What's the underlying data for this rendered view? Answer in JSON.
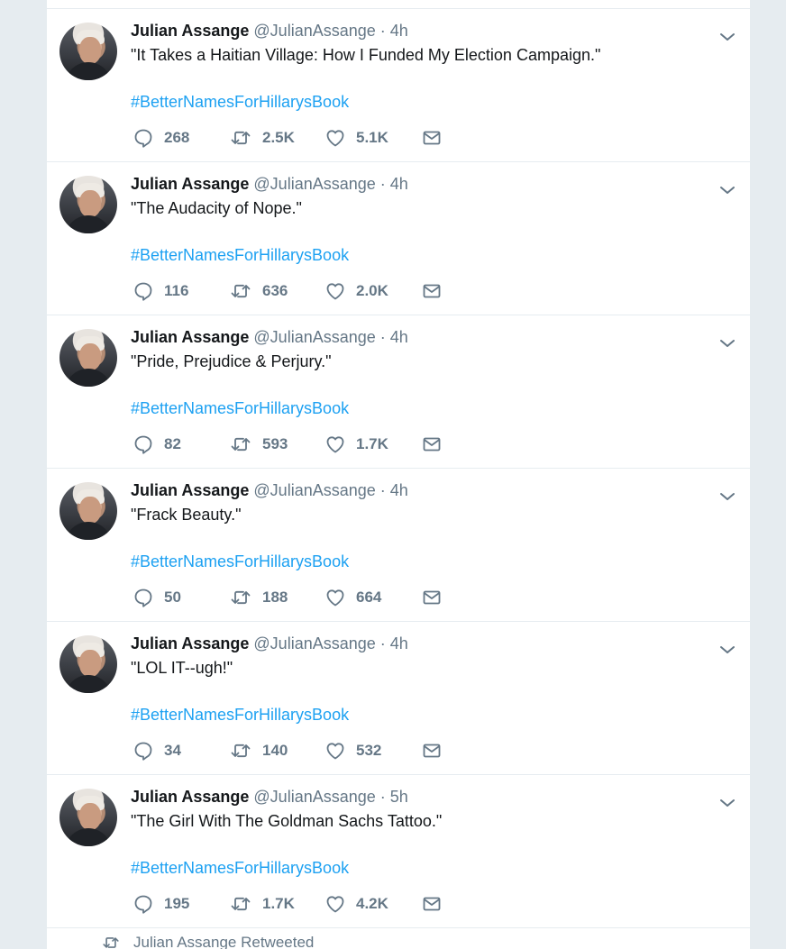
{
  "icons": {
    "reply": "speech-bubble-icon",
    "retweet": "retweet-arrows-icon",
    "like": "heart-icon",
    "dm": "envelope-icon",
    "caret": "chevron-down-icon"
  },
  "colors": {
    "link": "#1da1f2",
    "secondary_text": "#657786",
    "primary_text": "#14171a",
    "background": "#e6ecf0"
  },
  "tweets": [
    {
      "name": "Julian Assange",
      "handle": "@JulianAssange",
      "separator": "·",
      "time": "4h",
      "text": "\"It Takes a Haitian Village: How I Funded My Election Campaign.\"",
      "hashtag": "#BetterNamesForHillarysBook",
      "replies": "268",
      "retweets": "2.5K",
      "likes": "5.1K"
    },
    {
      "name": "Julian Assange",
      "handle": "@JulianAssange",
      "separator": "·",
      "time": "4h",
      "text": "\"The Audacity of Nope.\"",
      "hashtag": "#BetterNamesForHillarysBook",
      "replies": "116",
      "retweets": "636",
      "likes": "2.0K"
    },
    {
      "name": "Julian Assange",
      "handle": "@JulianAssange",
      "separator": "·",
      "time": "4h",
      "text": "\"Pride, Prejudice & Perjury.\"",
      "hashtag": "#BetterNamesForHillarysBook",
      "replies": "82",
      "retweets": "593",
      "likes": "1.7K"
    },
    {
      "name": "Julian Assange",
      "handle": "@JulianAssange",
      "separator": "·",
      "time": "4h",
      "text": "\"Frack Beauty.\"",
      "hashtag": "#BetterNamesForHillarysBook",
      "replies": "50",
      "retweets": "188",
      "likes": "664"
    },
    {
      "name": "Julian Assange",
      "handle": "@JulianAssange",
      "separator": "·",
      "time": "4h",
      "text": "\"LOL IT--ugh!\"",
      "hashtag": "#BetterNamesForHillarysBook",
      "replies": "34",
      "retweets": "140",
      "likes": "532"
    },
    {
      "name": "Julian Assange",
      "handle": "@JulianAssange",
      "separator": "·",
      "time": "5h",
      "text": "\"The Girl With The Goldman Sachs Tattoo.\"",
      "hashtag": "#BetterNamesForHillarysBook",
      "replies": "195",
      "retweets": "1.7K",
      "likes": "4.2K"
    }
  ],
  "retweeted_bar": {
    "label": "Julian Assange Retweeted"
  }
}
